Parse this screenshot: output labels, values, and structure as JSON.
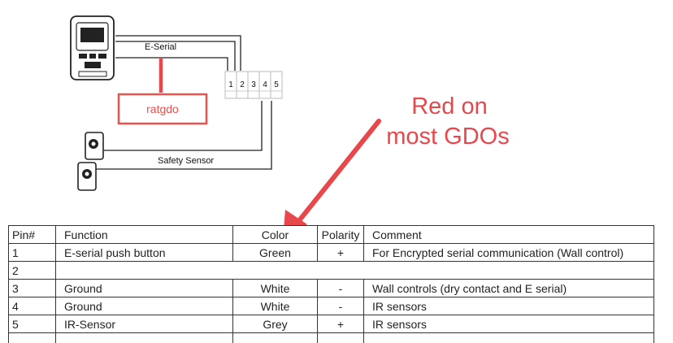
{
  "diagram": {
    "eserial_label": "E-Serial",
    "safety_sensor_label": "Safety Sensor",
    "terminal_numbers": [
      "1",
      "2",
      "3",
      "4",
      "5"
    ],
    "ratgdo_label": "ratgdo",
    "annotation_line1": "Red on",
    "annotation_line2": "most GDOs",
    "accent_color": "#e8474c"
  },
  "table": {
    "headers": [
      "Pin#",
      "Function",
      "Color",
      "Polarity",
      "Comment"
    ],
    "rows": [
      {
        "pin": "1",
        "function": "E-serial push button",
        "color": "Green",
        "polarity": "+",
        "comment": "For Encrypted serial communication (Wall control)"
      },
      {
        "pin": "2",
        "function": "",
        "color": "",
        "polarity": "",
        "comment": ""
      },
      {
        "pin": "3",
        "function": "Ground",
        "color": "White",
        "polarity": "-",
        "comment": "Wall controls (dry contact and E serial)"
      },
      {
        "pin": "4",
        "function": "Ground",
        "color": "White",
        "polarity": "-",
        "comment": "IR sensors"
      },
      {
        "pin": "5",
        "function": "IR-Sensor",
        "color": "Grey",
        "polarity": "+",
        "comment": "IR sensors"
      }
    ]
  }
}
